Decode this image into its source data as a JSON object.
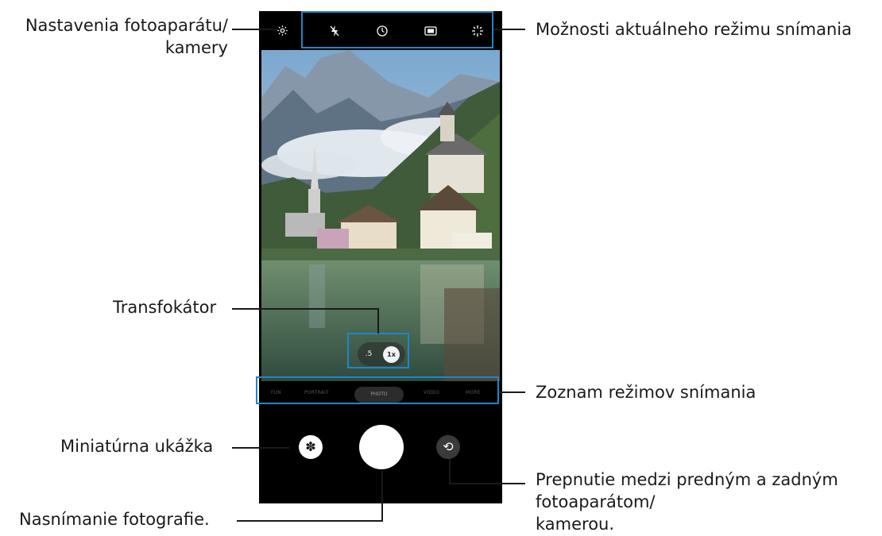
{
  "camera": {
    "top_icons": {
      "settings": "gear-icon",
      "flash": "flash-off-icon",
      "timer": "timer-icon",
      "ratio": "aspect-ratio-icon",
      "filters": "sparkle-icon"
    },
    "zoom": {
      "inactive": ".5",
      "active": "1x"
    },
    "modes": [
      "FUN",
      "PORTRAIT",
      "PHOTO",
      "VIDEO",
      "MORE"
    ],
    "active_mode": "PHOTO",
    "highlight_color": "#1f86c8"
  },
  "labels": {
    "settings": [
      "Nastavenia fotoaparátu/",
      "kamery"
    ],
    "options": "Možnosti aktuálneho režimu snímania",
    "zoom": "Transfokátor",
    "modes": "Zoznam režimov snímania",
    "preview": "Miniatúrna ukážka",
    "shutter": "Nasnímanie fotografie.",
    "switch": [
      "Prepnutie medzi predným a zadným",
      "fotoaparátom/",
      "kamerou."
    ]
  }
}
